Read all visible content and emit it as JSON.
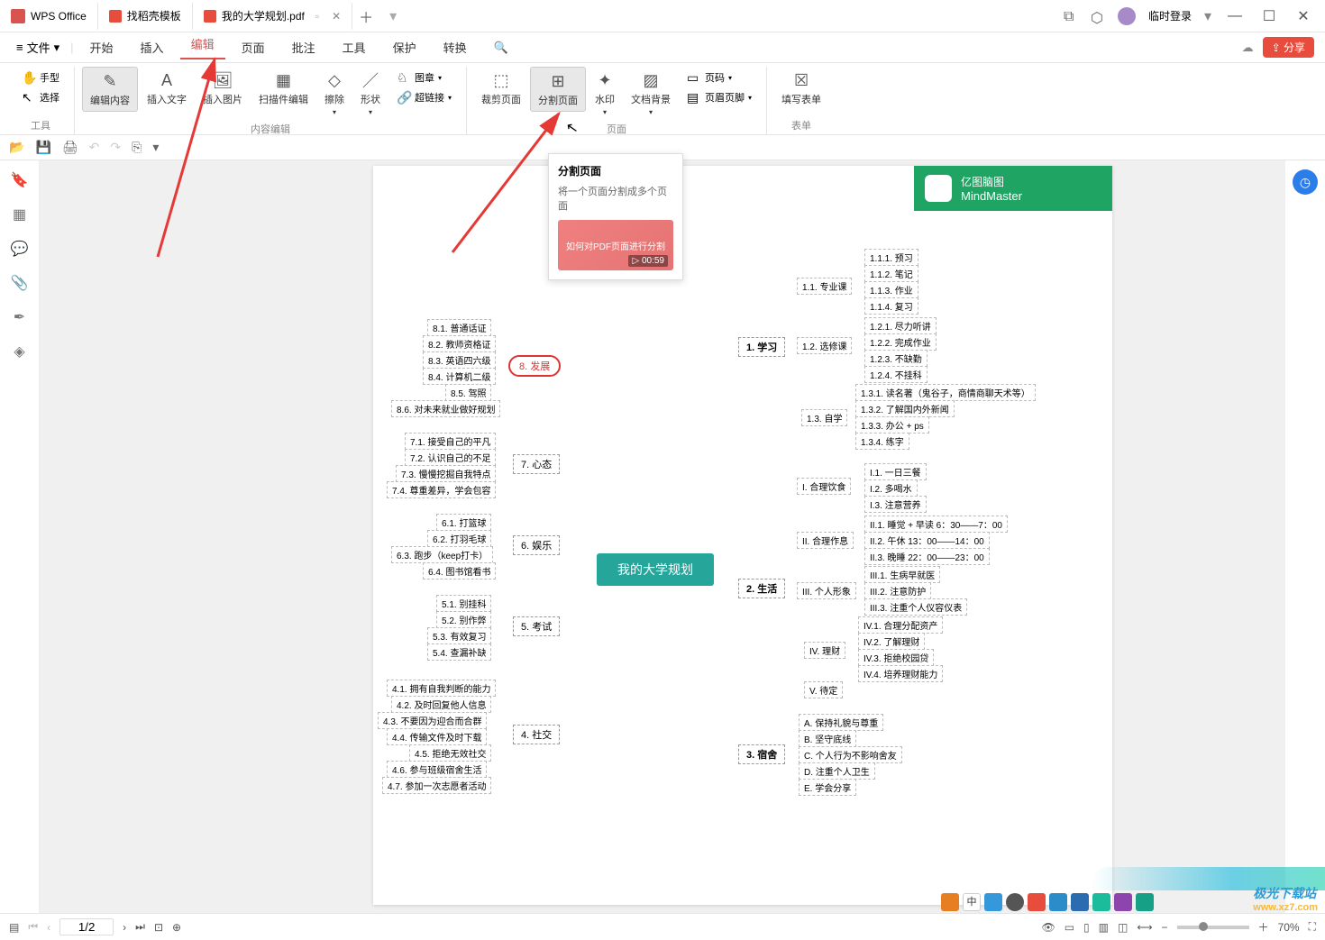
{
  "titlebar": {
    "app_name": "WPS Office",
    "tab1": "找稻壳模板",
    "tab2": "我的大学规划.pdf",
    "login": "临时登录"
  },
  "menubar": {
    "file": "文件",
    "items": [
      "开始",
      "插入",
      "编辑",
      "页面",
      "批注",
      "工具",
      "保护",
      "转换"
    ],
    "share": "分享"
  },
  "ribbon": {
    "hand": "手型",
    "select": "选择",
    "group_tools": "工具",
    "edit_content": "编辑内容",
    "insert_text": "插入文字",
    "insert_image": "插入图片",
    "scan_edit": "扫描件编辑",
    "erase": "擦除",
    "shape": "形状",
    "stamp": "图章",
    "hyperlink": "超链接",
    "group_content": "内容编辑",
    "crop_page": "裁剪页面",
    "split_page": "分割页面",
    "watermark": "水印",
    "doc_bg": "文档背景",
    "page_num": "页码",
    "header_footer": "页眉页脚",
    "group_page": "页面",
    "fill_form": "填写表单",
    "group_form": "表单"
  },
  "tooltip": {
    "title": "分割页面",
    "desc": "将一个页面分割成多个页面",
    "thumb_label": "如何对PDF页面进行分割",
    "duration": "00:59"
  },
  "mindmap": {
    "brand_cn": "亿图脑图",
    "brand_en": "MindMaster",
    "center": "我的大学规划",
    "branch1": "1. 学习",
    "b1_1": "1.1. 专业课",
    "b1_2": "1.2. 选修课",
    "b1_3": "1.3. 自学",
    "b1_1_1": "1.1.1. 预习",
    "b1_1_2": "1.1.2. 笔记",
    "b1_1_3": "1.1.3. 作业",
    "b1_1_4": "1.1.4. 复习",
    "b1_2_1": "1.2.1. 尽力听讲",
    "b1_2_2": "1.2.2. 完成作业",
    "b1_2_3": "1.2.3. 不缺勤",
    "b1_2_4": "1.2.4. 不挂科",
    "b1_3_1": "1.3.1. 读名著（鬼谷子，商情商聊天术等）",
    "b1_3_2": "1.3.2. 了解国内外新闻",
    "b1_3_3": "1.3.3. 办公 + ps",
    "b1_3_4": "1.3.4. 练字",
    "branch2": "2. 生活",
    "b2_1": "I. 合理饮食",
    "b2_2": "II. 合理作息",
    "b2_3": "III. 个人形象",
    "b2_4": "IV. 理财",
    "b2_5": "V. 待定",
    "b2_1_1": "I.1. 一日三餐",
    "b2_1_2": "I.2. 多喝水",
    "b2_1_3": "I.3. 注意营养",
    "b2_2_1": "II.1. 睡觉 + 早读 6：30——7：00",
    "b2_2_2": "II.2. 午休 13：00——14：00",
    "b2_2_3": "II.3. 晚睡 22：00——23：00",
    "b2_3_1": "III.1. 生病早就医",
    "b2_3_2": "III.2. 注意防护",
    "b2_3_3": "III.3. 注重个人仪容仪表",
    "b2_4_1": "IV.1. 合理分配资产",
    "b2_4_2": "IV.2. 了解理财",
    "b2_4_3": "IV.3. 拒绝校园贷",
    "b2_4_4": "IV.4. 培养理财能力",
    "branch3": "3. 宿舍",
    "b3_a": "A. 保持礼貌与尊重",
    "b3_b": "B. 坚守底线",
    "b3_c": "C. 个人行为不影响舍友",
    "b3_d": "D. 注重个人卫生",
    "b3_e": "E. 学会分享",
    "branch4": "4. 社交",
    "b4_1": "4.1. 拥有自我判断的能力",
    "b4_2": "4.2. 及时回复他人信息",
    "b4_3": "4.3. 不要因为迎合而合群",
    "b4_4": "4.4. 传输文件及时下载",
    "b4_5": "4.5. 拒绝无效社交",
    "b4_6": "4.6. 参与班级宿舍生活",
    "b4_7": "4.7. 参加一次志愿者活动",
    "branch5": "5. 考试",
    "b5_1": "5.1. 别挂科",
    "b5_2": "5.2. 别作弊",
    "b5_3": "5.3. 有效复习",
    "b5_4": "5.4. 查漏补缺",
    "branch6": "6. 娱乐",
    "b6_1": "6.1. 打篮球",
    "b6_2": "6.2. 打羽毛球",
    "b6_3": "6.3. 跑步（keep打卡）",
    "b6_4": "6.4. 图书馆看书",
    "branch7": "7. 心态",
    "b7_1": "7.1. 接受自己的平凡",
    "b7_2": "7.2. 认识自己的不足",
    "b7_3": "7.3. 慢慢挖掘自我特点",
    "b7_4": "7.4. 尊重差异，学会包容",
    "branch8": "8. 发展",
    "b8_1": "8.1. 普通话证",
    "b8_2": "8.2. 教师资格证",
    "b8_3": "8.3. 英语四六级",
    "b8_4": "8.4. 计算机二级",
    "b8_5": "8.5. 驾照",
    "b8_6": "8.6. 对未来就业做好规划"
  },
  "statusbar": {
    "page": "1/2",
    "zoom": "70%"
  },
  "watermark": {
    "site_cn": "极光下载站",
    "site_url": "www.xz7.com"
  }
}
